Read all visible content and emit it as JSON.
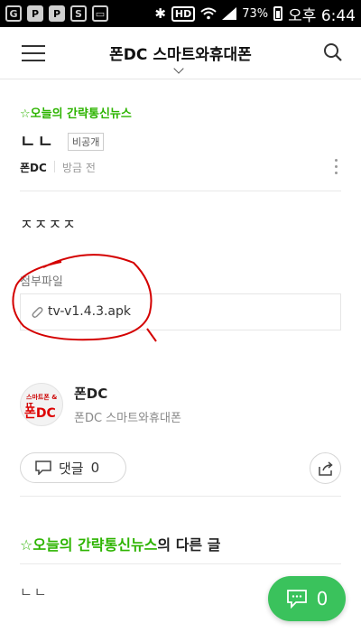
{
  "status_bar": {
    "battery": "73%",
    "time": "오후 6:44",
    "hd": "HD",
    "icons": [
      "g-icon",
      "p-icon",
      "p-icon",
      "s-icon",
      "gallery-icon",
      "bluetooth-icon",
      "wifi-icon",
      "signal-icon",
      "battery-icon"
    ]
  },
  "header": {
    "title": "폰DC 스마트와휴대폰"
  },
  "post": {
    "board": "☆오늘의 간략통신뉴스",
    "title": "ㄴㄴ",
    "private_badge": "비공개",
    "author": "폰DC",
    "time": "방금 전",
    "body": "ㅈㅈㅈㅈ",
    "attachment_label": "첨부파일",
    "attachment_file": "tv-v1.4.3.apk"
  },
  "profile": {
    "name": "폰DC",
    "cafe": "폰DC 스마트와휴대폰",
    "avatar_text_top": "스마트폰 & IT",
    "avatar_text_main": "폰DC"
  },
  "actions": {
    "comment_label": "댓글",
    "comment_count": "0"
  },
  "other_posts": {
    "board": "☆오늘의 간략통신뉴스",
    "suffix": "의 다른 글",
    "items": [
      "ㄴㄴ"
    ]
  },
  "fab": {
    "count": "0"
  },
  "colors": {
    "accent_green": "#2db400",
    "fab_green": "#3ac25c",
    "annotation_red": "#d40000"
  }
}
